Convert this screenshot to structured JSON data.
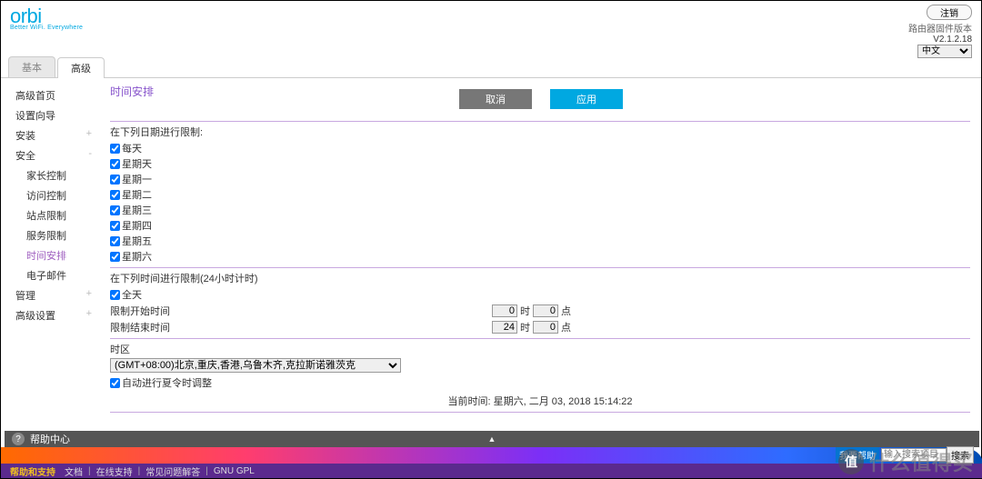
{
  "header": {
    "logo": "orbi",
    "tagline": "Better WiFi. Everywhere",
    "logout": "注销",
    "firmware_label": "路由器固件版本",
    "firmware_version": "V2.1.2.18",
    "language": "中文"
  },
  "tabs": {
    "basic": "基本",
    "advanced": "高级"
  },
  "sidebar": {
    "home": "高级首页",
    "wizard": "设置向导",
    "install": "安装",
    "security_group": "安全",
    "security": {
      "parental": "家长控制",
      "access": "访问控制",
      "sitebound": "站点限制",
      "service": "服务限制",
      "schedule": "时间安排",
      "email": "电子邮件"
    },
    "manage": "管理",
    "adv": "高级设置"
  },
  "page": {
    "title": "时间安排",
    "btn_cancel": "取消",
    "btn_apply": "应用",
    "days_label": "在下列日期进行限制:",
    "days": {
      "everyday": "每天",
      "sunday": "星期天",
      "monday": "星期一",
      "tuesday": "星期二",
      "wednesday": "星期三",
      "thursday": "星期四",
      "friday": "星期五",
      "saturday": "星期六"
    },
    "times_label": "在下列时间进行限制(24小时计时)",
    "allday": "全天",
    "start_label": "限制开始时间",
    "end_label": "限制结束时间",
    "start_h": "0",
    "start_m": "0",
    "end_h": "24",
    "end_m": "0",
    "unit_h": "时",
    "unit_m": "点",
    "tz_label": "时区",
    "tz_value": "(GMT+08:00)北京,重庆,香港,乌鲁木齐,克拉斯诺雅茨克",
    "dst": "自动进行夏令时调整",
    "current_prefix": "当前时间: ",
    "current_value": "星期六, 二月 03, 2018 15:14:22"
  },
  "help": {
    "title": "帮助中心"
  },
  "footer": {
    "title": "帮助和支持",
    "links": [
      "文档",
      "在线支持",
      "常见问题解答",
      "GNU GPL"
    ]
  },
  "search": {
    "hint_label": "我要帮助",
    "placeholder": "输入搜索项目",
    "btn": "搜索"
  },
  "watermark": {
    "badge": "值",
    "text": "什么值得买"
  }
}
